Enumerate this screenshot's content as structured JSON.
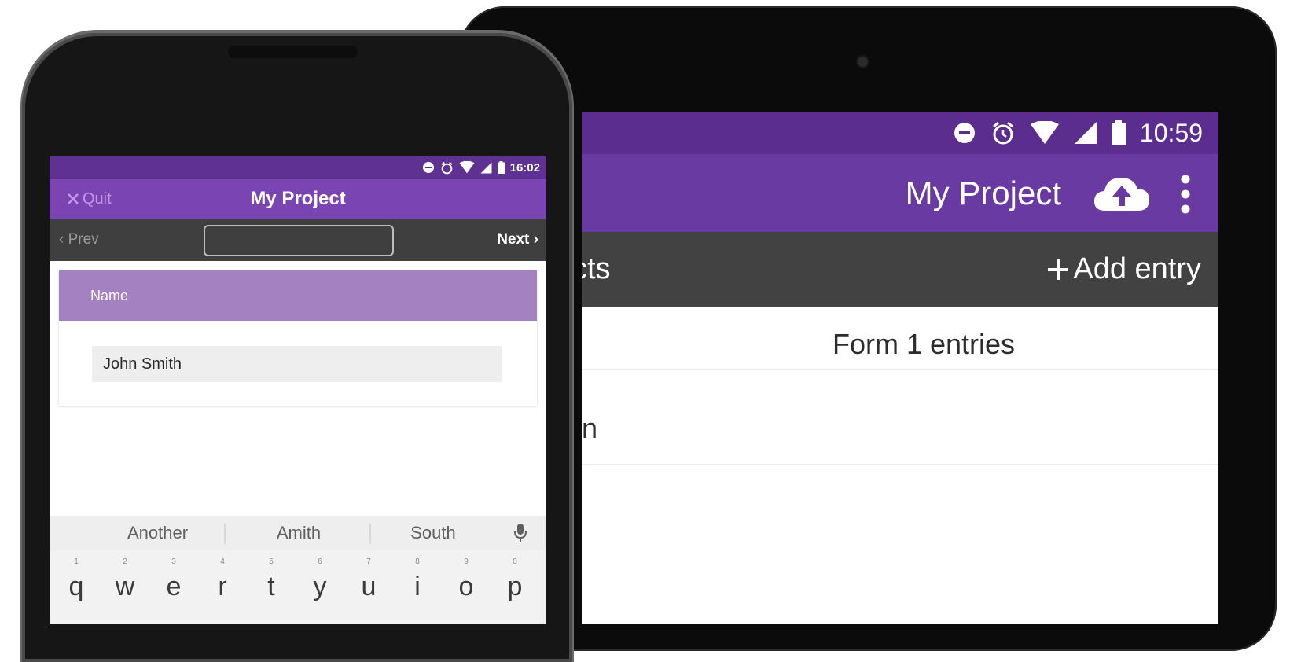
{
  "tablet": {
    "status": {
      "time": "10:59"
    },
    "app_title": "My Project",
    "subbar_title": "cts",
    "add_entry_label": "Add entry",
    "add_entry_icon": "plus-icon",
    "form_heading": "Form 1 entries",
    "entries": [
      "hn"
    ],
    "icons": [
      "minus-circle-icon",
      "alarm-icon",
      "wifi-icon",
      "signal-icon",
      "battery-icon",
      "cloud-upload-icon",
      "more-vert-icon"
    ]
  },
  "phone": {
    "status": {
      "time": "16:02"
    },
    "quit_label": "Quit",
    "app_title": "My Project",
    "prev_label": "Prev",
    "next_label": "Next",
    "field": {
      "label": "Name",
      "value": "John Smith"
    },
    "suggestions": [
      "Another",
      "Amith",
      "South"
    ],
    "keyboard_row": [
      {
        "num": "1",
        "key": "q"
      },
      {
        "num": "2",
        "key": "w"
      },
      {
        "num": "3",
        "key": "e"
      },
      {
        "num": "4",
        "key": "r"
      },
      {
        "num": "5",
        "key": "t"
      },
      {
        "num": "6",
        "key": "y"
      },
      {
        "num": "7",
        "key": "u"
      },
      {
        "num": "8",
        "key": "i"
      },
      {
        "num": "9",
        "key": "o"
      },
      {
        "num": "0",
        "key": "p"
      }
    ]
  },
  "colors": {
    "status_purple": "#5b2d8e",
    "appbar_purple": "#6a3aa3",
    "card_header_purple": "#a481c0",
    "toolbar_gray": "#424242"
  }
}
